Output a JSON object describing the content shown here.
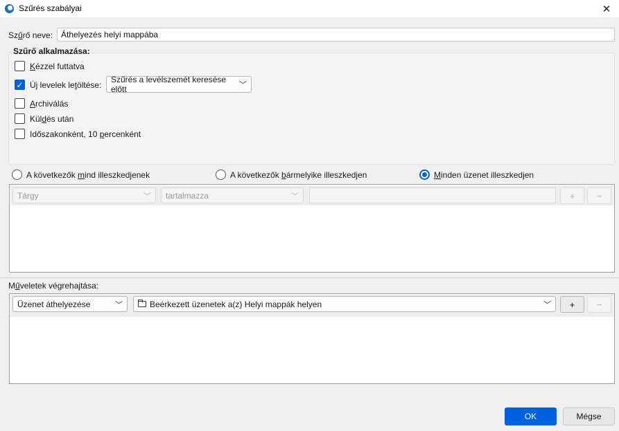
{
  "window": {
    "title": "Szűrés szabályai"
  },
  "filter_name": {
    "label_pre": "Sz",
    "label_u": "ű",
    "label_post": "rő neve:",
    "value": "Áthelyezés helyi mappába"
  },
  "apply": {
    "legend": "Szűrő alkalmazása:",
    "manual": {
      "u": "K",
      "rest": "ézzel futtatva",
      "checked": false
    },
    "new_mail": {
      "pre": "Új levelek le",
      "u": "t",
      "post": "öltése:",
      "checked": true,
      "timing_value": "Szűrés a levélszemét keresése előtt"
    },
    "archive": {
      "u": "A",
      "rest": "rchiválás",
      "checked": false
    },
    "after_send": {
      "pre": "Kül",
      "u": "d",
      "post": "és után",
      "checked": false
    },
    "periodic": {
      "pre": "Időszakonként, 10 ",
      "u": "p",
      "post": "ercenként",
      "checked": false
    }
  },
  "match": {
    "all": {
      "pre": "A következők ",
      "u": "m",
      "post": "ind illeszkedjenek",
      "checked": false
    },
    "any": {
      "pre": "A következők ",
      "u": "b",
      "post": "ármelyike illeszkedjen",
      "checked": false
    },
    "every": {
      "pre": "",
      "u": "M",
      "post": "inden üzenet illeszkedjen",
      "checked": true
    }
  },
  "condition": {
    "field": "Tárgy",
    "operator": "tartalmazza",
    "value": "",
    "add_label": "+",
    "remove_label": "−"
  },
  "actions": {
    "label_pre": "M",
    "label_u": "ű",
    "label_post": "veletek végrehajtása:",
    "action_type": "Üzenet áthelyezése",
    "target_folder": "Beérkezett üzenetek a(z) Helyi mappák helyen",
    "add_label": "+",
    "remove_label": "−"
  },
  "footer": {
    "ok": "OK",
    "cancel": "Mégse"
  },
  "icons": {
    "app": "thunderbird-icon",
    "close": "close-icon",
    "chevron": "chevron-down-icon",
    "folder": "folder-icon"
  },
  "colors": {
    "accent": "#0060df",
    "ok_button": "#0061e0"
  }
}
